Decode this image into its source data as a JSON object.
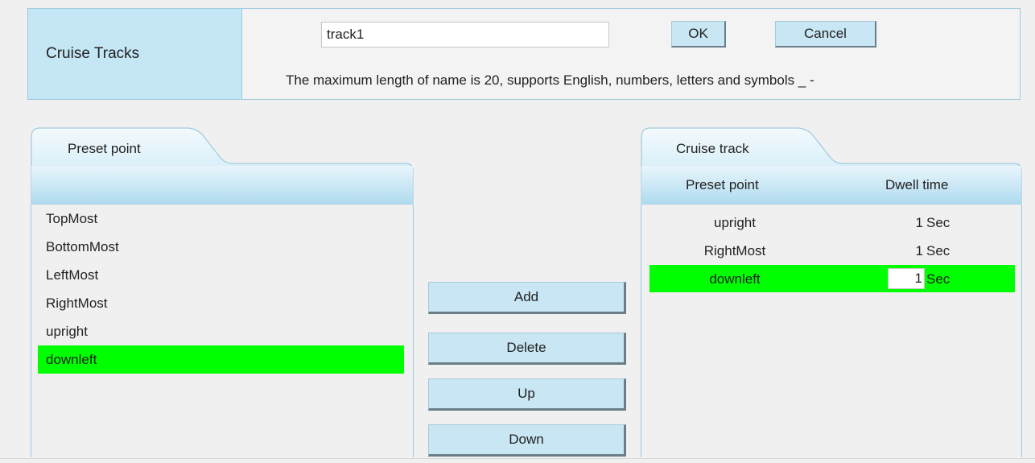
{
  "header": {
    "label": "Cruise Tracks",
    "name_value": "track1",
    "ok_label": "OK",
    "cancel_label": "Cancel",
    "hint": "The maximum length of name is 20, supports English, numbers, letters and symbols _ -"
  },
  "left_panel": {
    "tab_title": "Preset point",
    "items": [
      {
        "label": "TopMost",
        "selected": false
      },
      {
        "label": "BottomMost",
        "selected": false
      },
      {
        "label": "LeftMost",
        "selected": false
      },
      {
        "label": "RightMost",
        "selected": false
      },
      {
        "label": "upright",
        "selected": false
      },
      {
        "label": "downleft",
        "selected": true
      }
    ]
  },
  "actions": {
    "add": "Add",
    "delete": "Delete",
    "up": "Up",
    "down": "Down"
  },
  "right_panel": {
    "tab_title": "Cruise track",
    "col_preset": "Preset point",
    "col_dwell": "Dwell time",
    "unit": "Sec",
    "rows": [
      {
        "point": "upright",
        "dwell": "1",
        "selected": false
      },
      {
        "point": "RightMost",
        "dwell": "1",
        "selected": false
      },
      {
        "point": "downleft",
        "dwell": "1",
        "selected": true
      }
    ]
  },
  "colors": {
    "selection": "#00ff00",
    "header_bg": "#c5e6f4",
    "button_bg": "#c8e6f3",
    "border": "#9fc9de"
  }
}
